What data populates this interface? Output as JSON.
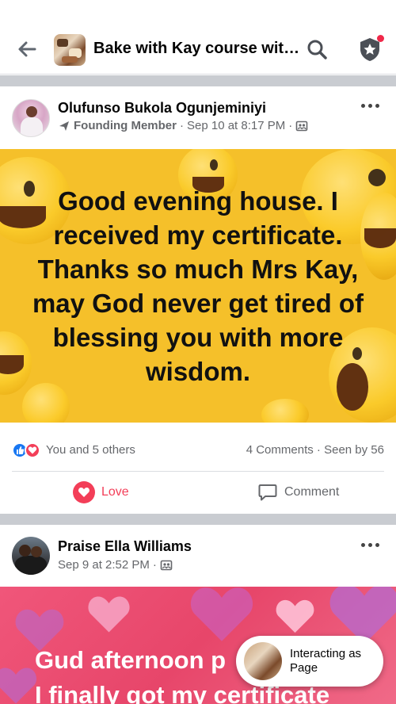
{
  "header": {
    "title": "Bake with Kay course wit…",
    "back_icon": "arrow-left-icon",
    "search_icon": "search-icon",
    "shield_icon": "admin-shield-icon",
    "notification_color": "#f02849"
  },
  "posts": [
    {
      "author": "Olufunso Bukola Ogunjeminiyi",
      "badge": "Founding Member",
      "timestamp": "Sep 10 at 8:17 PM",
      "privacy_icon": "group-members-icon",
      "body": "Good evening house. I received my certificate. Thanks so much Mrs Kay, may God never get tired of blessing you with more wisdom.",
      "background_color": "#f5c02a",
      "reactions_text": "You and 5 others",
      "comments_text": "4 Comments",
      "seen_text": "Seen by 56",
      "love_label": "Love",
      "comment_label": "Comment"
    },
    {
      "author": "Praise Ella Williams",
      "timestamp": "Sep 9 at 2:52 PM",
      "privacy_icon": "group-members-icon",
      "body_line1": "Gud afternoon p",
      "body_line2": "I finally got my certificate",
      "background_color": "#e7466a"
    }
  ],
  "interacting_chip": {
    "label": "Interacting as Page"
  },
  "colors": {
    "like_blue": "#1877f2",
    "love_red": "#f33e58",
    "secondary_text": "#65676b"
  }
}
